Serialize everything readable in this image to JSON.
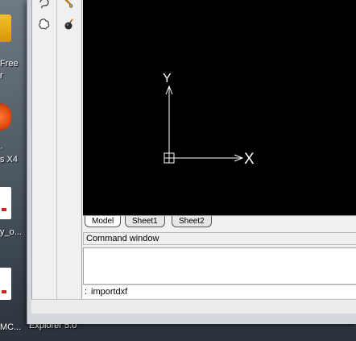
{
  "desktop": {
    "icon1_label": "Free",
    "icon1_label2": "r",
    "icon2_label": "s X4",
    "icon3_label": "y_o...",
    "icon4_label": "MC...",
    "bottom_label": "Explorer 5.0"
  },
  "toolbar1": {
    "icons": [
      "lasso-icon",
      "cloud-icon"
    ]
  },
  "toolbar2": {
    "icons": [
      "paintbrush-icon",
      "bomb-icon"
    ]
  },
  "canvas": {
    "background": "#000000",
    "axis_color": "#ffffff",
    "x_label": "X",
    "y_label": "Y"
  },
  "tabs": [
    {
      "label": "Model",
      "active": true
    },
    {
      "label": "Sheet1",
      "active": false
    },
    {
      "label": "Sheet2",
      "active": false
    }
  ],
  "command_window": {
    "title": "Command window",
    "prompt": ":",
    "input_value": "importdxf"
  }
}
